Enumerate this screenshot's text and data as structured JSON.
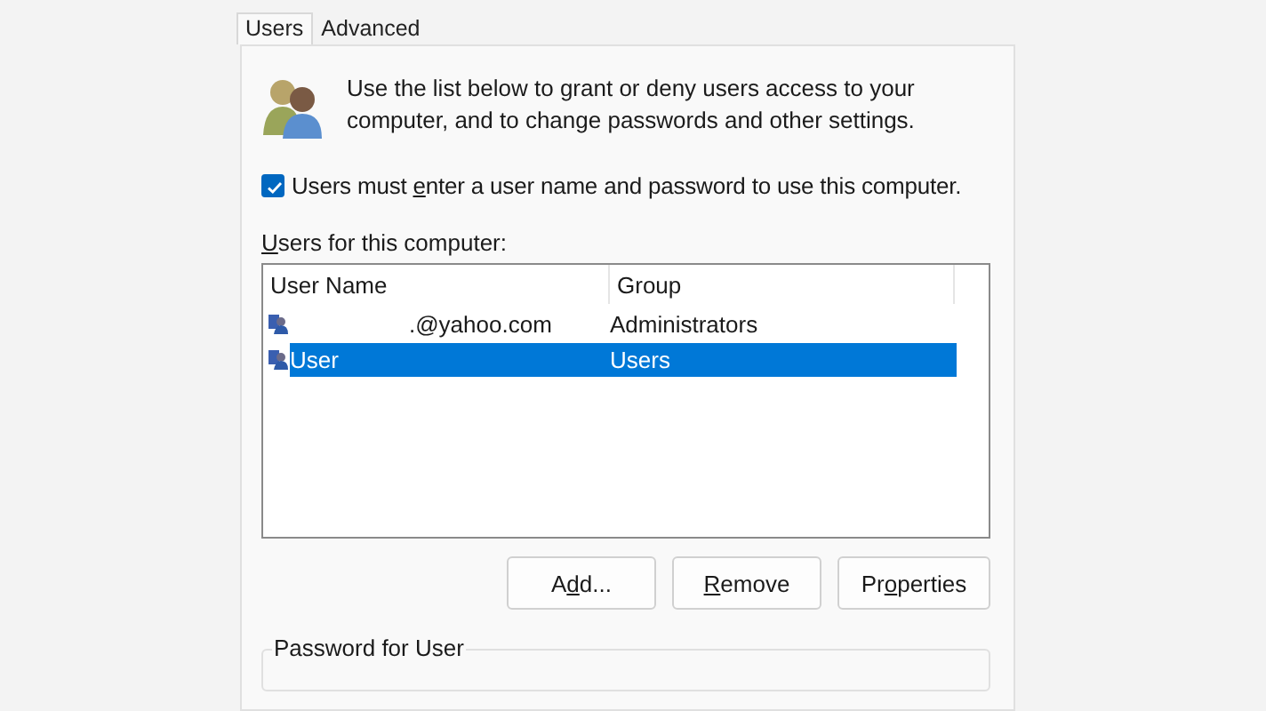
{
  "tabs": [
    {
      "label": "Users",
      "selected": true
    },
    {
      "label": "Advanced",
      "selected": false
    }
  ],
  "intro": {
    "text": "Use the list below to grant or deny users access to your computer, and to change passwords and other settings."
  },
  "require_login": {
    "label": {
      "before": "Users must ",
      "key": "e",
      "after": "nter a user name and password to use this computer."
    },
    "checked": true
  },
  "users_label": {
    "label": {
      "key": "U",
      "after": "sers for this computer:"
    }
  },
  "table": {
    "columns": [
      "User Name",
      "Group"
    ],
    "rows": [
      {
        "user_name": ".@yahoo.com",
        "redacted": true,
        "group": "Administrators",
        "selected": false
      },
      {
        "user_name": "User",
        "redacted": false,
        "group": "Users",
        "selected": true
      }
    ]
  },
  "buttons": [
    {
      "label": {
        "before": "A",
        "key": "d",
        "after": "d..."
      }
    },
    {
      "label": {
        "key": "R",
        "after": "emove"
      }
    },
    {
      "label": {
        "before": "Pr",
        "key": "o",
        "after": "perties"
      }
    }
  ],
  "password_group": {
    "title": "Password for User"
  }
}
